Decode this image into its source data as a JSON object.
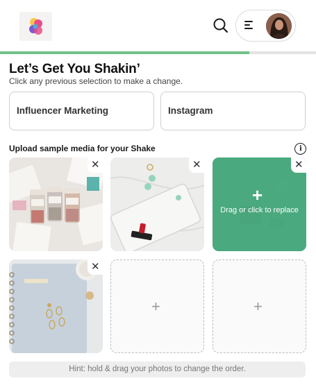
{
  "header": {
    "logo_icon": "shakebrand-logo-icon",
    "search_icon": "search-icon",
    "menu_icon": "hamburger-menu-icon",
    "avatar_icon": "user-avatar"
  },
  "progress": {
    "percent": 79,
    "color": "#72c187"
  },
  "heading": {
    "title": "Let’s Get You Shakin’",
    "subtitle": "Click any previous selection to make a change."
  },
  "selections": [
    {
      "label": "Influencer Marketing"
    },
    {
      "label": "Instagram"
    }
  ],
  "upload": {
    "label": "Upload sample media for your Shake",
    "info_icon": "info-icon"
  },
  "media": {
    "tiles": [
      {
        "kind": "photo",
        "subject": "bath-salt-jars-flatlay",
        "close_symbol": "✕"
      },
      {
        "kind": "photo",
        "subject": "pouch-lipstick-flatlay",
        "close_symbol": "✕"
      },
      {
        "kind": "photo-replace",
        "subject": "green-overlay",
        "close_symbol": "✕",
        "plus_symbol": "+",
        "replace_text": "Drag or click to replace"
      },
      {
        "kind": "photo",
        "subject": "notebook-earrings-flatlay",
        "close_symbol": "✕"
      },
      {
        "kind": "empty",
        "plus_symbol": "+"
      },
      {
        "kind": "empty",
        "plus_symbol": "+"
      }
    ],
    "accent_color": "#4baa80"
  },
  "hint": {
    "text": "Hint: hold & drag your photos to change the order."
  }
}
